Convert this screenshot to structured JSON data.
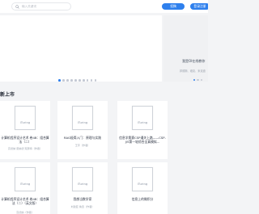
{
  "header": {
    "search_placeholder": "输入关键词",
    "button_1": "投稿",
    "button_2": "登录注册"
  },
  "hero": {
    "dots": 10,
    "active_dot": 0
  },
  "side_panel": {
    "title": "我是OI在线教你",
    "subtitle": "邦德斯、维克、米克迪"
  },
  "section": {
    "title": "新上市"
  },
  "cards": [
    {
      "cover": "iTuring",
      "title": "计算机程序设计艺术 卷4B：组合算法（二）",
      "meta": "高德纳 唐纳德·克努特（作者）"
    },
    {
      "cover": "iTuring",
      "title": "RAG极简入门：原理与实践",
      "meta": "王宇（作者）"
    },
    {
      "cover": "iTuring",
      "title": "信息学奥赛CSP通关上路——CSP-J/S第一轮综合全真模拟...",
      "meta": ""
    },
    {
      "cover": "iTuring",
      "title": "计算机程序设计艺术 卷4B：组合算法（二）（英文版）",
      "meta": "高德纳（作者）"
    },
    {
      "cover": "iTuring",
      "title": "我想当数学家",
      "meta": "刘建亚 鲁迅（作者）"
    },
    {
      "cover": "iTuring",
      "title": "信息上的微积分",
      "meta": ""
    }
  ]
}
